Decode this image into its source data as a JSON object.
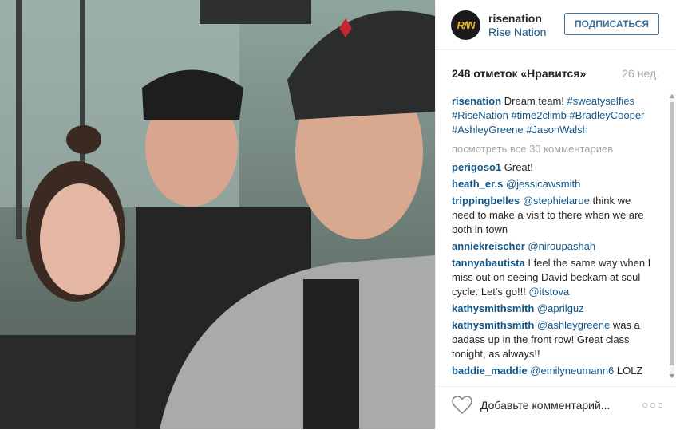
{
  "post": {
    "username": "risenation",
    "fullname": "Rise Nation",
    "avatar_text": "R/\\N",
    "follow_label": "ПОДПИСАТЬСЯ",
    "likes": "248 отметок «Нравится»",
    "time": "26 нед."
  },
  "caption": {
    "user": "risenation",
    "text": "Dream team!",
    "tags": [
      "#sweatyselfies",
      "#RiseNation",
      "#time2climb",
      "#BradleyCooper",
      "#AshleyGreene",
      "#JasonWalsh"
    ]
  },
  "view_all": "посмотреть все 30 комментариев",
  "comments": [
    {
      "user": "perigoso1",
      "pre": "Great!",
      "tag": "",
      "post": ""
    },
    {
      "user": "heath_er.s",
      "pre": "",
      "tag": "@jessicawsmith",
      "post": ""
    },
    {
      "user": "trippingbelles",
      "pre": "",
      "tag": "@stephielarue",
      "post": " think we need to make a visit to there when we are both in town"
    },
    {
      "user": "anniekreischer",
      "pre": "",
      "tag": "@niroupashah",
      "post": ""
    },
    {
      "user": "tannyabautista",
      "pre": "I feel the same way when I miss out on seeing David beckam at soul cycle. Let's go!!! ",
      "tag": "@itstova",
      "post": ""
    },
    {
      "user": "kathysmithsmith",
      "pre": "",
      "tag": "@aprilguz",
      "post": ""
    },
    {
      "user": "kathysmithsmith",
      "pre": "",
      "tag": "@ashleygreene",
      "post": " was a badass up in the front row! Great class tonight, as always!!"
    },
    {
      "user": "baddie_maddie",
      "pre": "",
      "tag": "@emilyneumann6",
      "post": " LOLZ"
    }
  ],
  "footer": {
    "add_comment": "Добавьте комментарий...",
    "more_dots": "○○○"
  },
  "colors": {
    "link": "#125688",
    "follow_border": "#3f729b",
    "muted": "#a5a7aa"
  }
}
